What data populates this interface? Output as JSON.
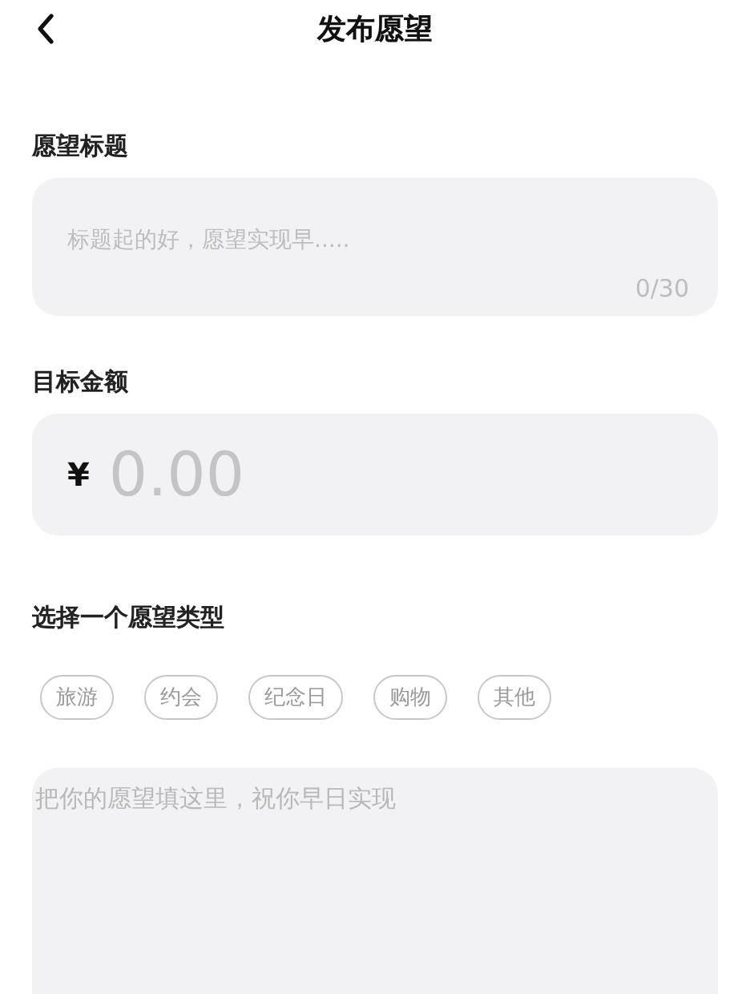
{
  "header": {
    "title": "发布愿望"
  },
  "title_field": {
    "label": "愿望标题",
    "placeholder": "标题起的好，愿望实现早.....",
    "counter": "0/30"
  },
  "amount_field": {
    "label": "目标金额",
    "currency": "¥",
    "placeholder": "0.00"
  },
  "wish_type": {
    "label": "选择一个愿望类型",
    "tags": [
      {
        "label": "旅游",
        "selected": false
      },
      {
        "label": "约会",
        "selected": false
      },
      {
        "label": "纪念日",
        "selected": false
      },
      {
        "label": "购物",
        "selected": false
      },
      {
        "label": "其他",
        "selected": false
      }
    ]
  },
  "description_field": {
    "placeholder": "把你的愿望填这里，祝你早日实现"
  }
}
